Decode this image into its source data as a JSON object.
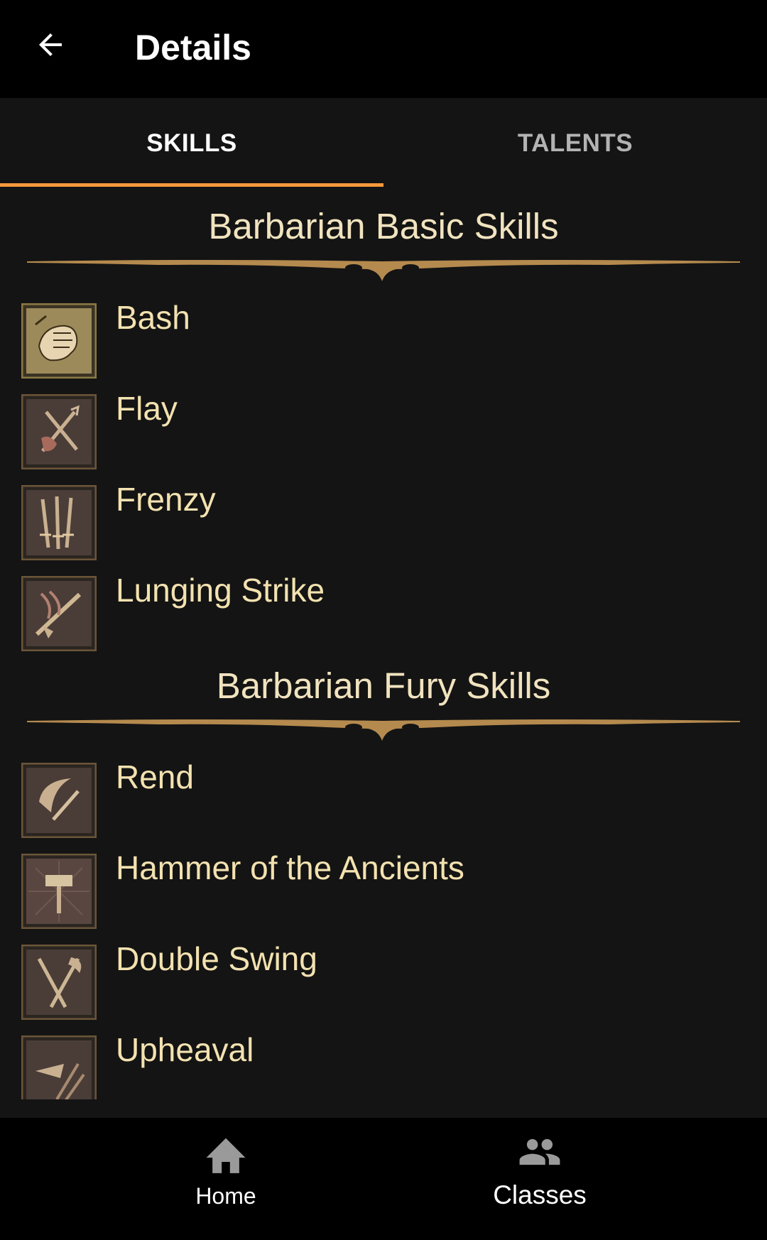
{
  "header": {
    "title": "Details",
    "back_icon": "arrow-back-icon"
  },
  "tabs": [
    {
      "label": "SKILLS",
      "active": true
    },
    {
      "label": "TALENTS",
      "active": false
    }
  ],
  "sections": [
    {
      "title": "Barbarian Basic Skills",
      "skills": [
        {
          "name": "Bash",
          "icon": "fist-icon"
        },
        {
          "name": "Flay",
          "icon": "flay-icon"
        },
        {
          "name": "Frenzy",
          "icon": "frenzy-icon"
        },
        {
          "name": "Lunging Strike",
          "icon": "lunging-strike-icon"
        }
      ]
    },
    {
      "title": "Barbarian Fury Skills",
      "skills": [
        {
          "name": "Rend",
          "icon": "rend-icon"
        },
        {
          "name": "Hammer of the Ancients",
          "icon": "hammer-icon"
        },
        {
          "name": "Double Swing",
          "icon": "double-swing-icon"
        },
        {
          "name": "Upheaval",
          "icon": "upheaval-icon"
        }
      ]
    }
  ],
  "bottom_nav": [
    {
      "label": "Home",
      "icon": "home-icon"
    },
    {
      "label": "Classes",
      "icon": "people-icon"
    }
  ],
  "colors": {
    "accent": "#f59a3d",
    "skill_text": "#f3e2b0",
    "section_title": "#f1e3bf",
    "background": "#141414",
    "bar": "#000000"
  }
}
